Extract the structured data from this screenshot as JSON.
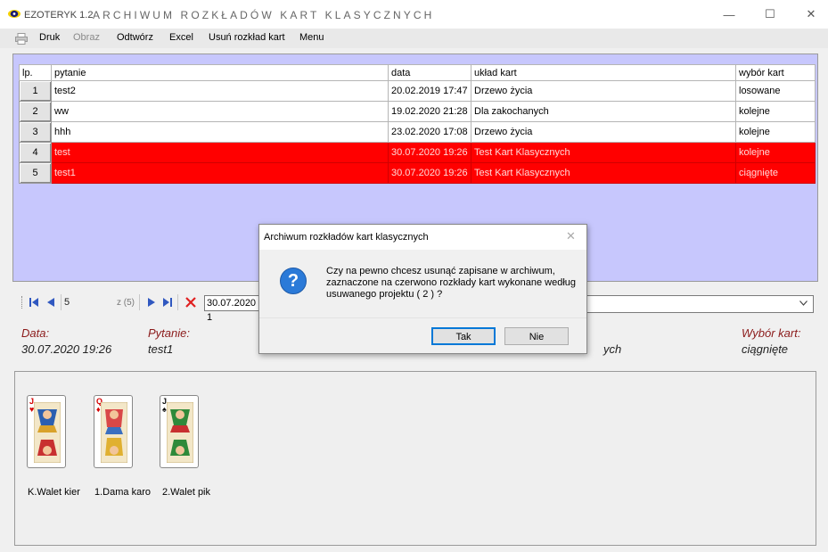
{
  "window": {
    "app_name": "EZOTERYK 1.2",
    "title": "ARCHIWUM ROZKŁADÓW KART KLASYCZNYCH",
    "minimize": "—",
    "maximize": "☐",
    "close": "✕"
  },
  "menu": {
    "print_icon": "printer-icon",
    "items": [
      "Druk",
      "Obraz",
      "Odtwórz",
      "Excel",
      "Usuń rozkład kart",
      "Menu"
    ]
  },
  "grid": {
    "headers": [
      "lp.",
      "pytanie",
      "data",
      "układ kart",
      "wybór kart"
    ],
    "rows": [
      {
        "lp": "1",
        "pytanie": "test2",
        "data": "20.02.2019 17:47",
        "uklad": "Drzewo życia",
        "wybor": "losowane",
        "marked": false
      },
      {
        "lp": "2",
        "pytanie": "ww",
        "data": "19.02.2020 21:28",
        "uklad": "Dla zakochanych",
        "wybor": "kolejne",
        "marked": false
      },
      {
        "lp": "3",
        "pytanie": "hhh",
        "data": "23.02.2020 17:08",
        "uklad": "Drzewo życia",
        "wybor": "kolejne",
        "marked": false
      },
      {
        "lp": "4",
        "pytanie": "test",
        "data": "30.07.2020 19:26",
        "uklad": "Test Kart Klasycznych",
        "wybor": "kolejne",
        "marked": true
      },
      {
        "lp": "5",
        "pytanie": "test1",
        "data": "30.07.2020 19:26",
        "uklad": "Test Kart Klasycznych",
        "wybor": "ciągnięte",
        "marked": true
      }
    ],
    "marked_color": "#ff0000"
  },
  "navigator": {
    "current": "5",
    "count": "z (5)",
    "date_value": "30.07.2020 1"
  },
  "details": {
    "data_label": "Data:",
    "data_value": "30.07.2020 19:26",
    "pytanie_label": "Pytanie:",
    "pytanie_value": "test1",
    "uklad_partial": "ych",
    "wybor_label": "Wybór kart:",
    "wybor_value": "ciągnięte"
  },
  "cards": [
    {
      "caption": "K.Walet kier",
      "rank": "J",
      "suit": "♥",
      "suit_color": "#d40000"
    },
    {
      "caption": "1.Dama karo",
      "rank": "Q",
      "suit": "♦",
      "suit_color": "#d40000"
    },
    {
      "caption": "2.Walet pik",
      "rank": "J",
      "suit": "♠",
      "suit_color": "#111111"
    }
  ],
  "dialog": {
    "title": "Archiwum rozkładów kart klasycznych",
    "close": "✕",
    "icon": "question-icon",
    "icon_glyph": "?",
    "lines": [
      "Czy na pewno chcesz usunąć zapisane w archiwum,",
      "zaznaczone na czerwono rozkłady kart wykonane według",
      "usuwanego projektu ( 2 )  ?"
    ],
    "yes": "Tak",
    "no": "Nie"
  }
}
